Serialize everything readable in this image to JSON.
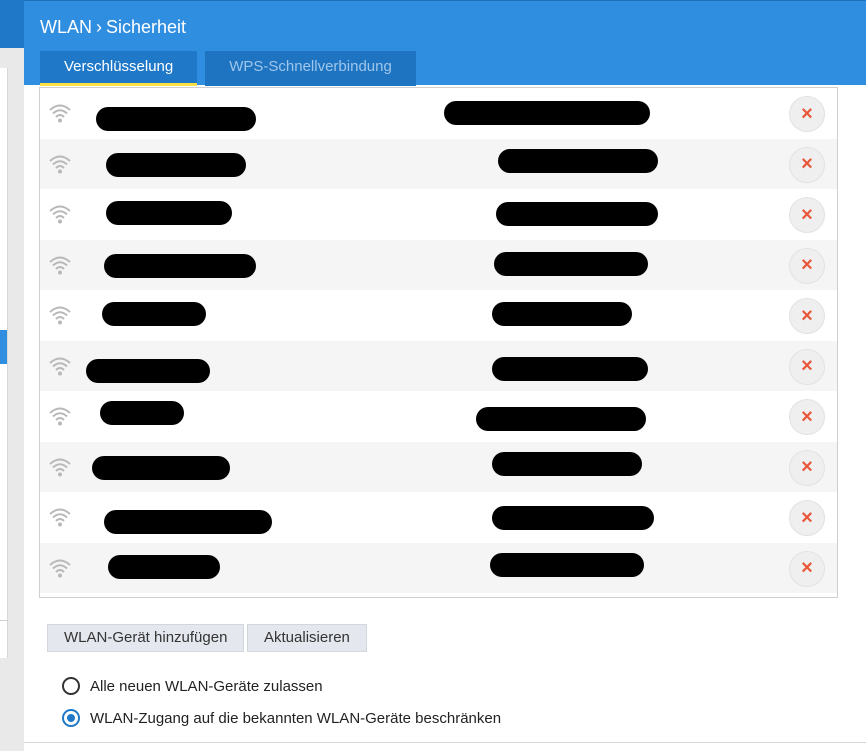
{
  "header": {
    "breadcrumb_root": "WLAN",
    "breadcrumb_sep": "›",
    "breadcrumb_current": "Sicherheit"
  },
  "tabs": [
    {
      "label": "Verschlüsselung",
      "active": true
    },
    {
      "label": "WPS-Schnellverbindung",
      "active": false
    }
  ],
  "device_list": {
    "rows": [
      {
        "icon": "wifi-icon",
        "name": "[redacted]",
        "address": "[redacted]",
        "delete": "×"
      },
      {
        "icon": "wifi-icon",
        "name": "[redacted]",
        "address": "[redacted]",
        "delete": "×"
      },
      {
        "icon": "wifi-icon",
        "name": "[redacted]",
        "address": "[redacted]",
        "delete": "×"
      },
      {
        "icon": "wifi-icon",
        "name": "[redacted]",
        "address": "[redacted]",
        "delete": "×"
      },
      {
        "icon": "wifi-icon",
        "name": "[redacted]",
        "address": "[redacted]",
        "delete": "×"
      },
      {
        "icon": "wifi-icon",
        "name": "[redacted]",
        "address": "[redacted]",
        "delete": "×"
      },
      {
        "icon": "wifi-icon",
        "name": "[redacted]",
        "address": "[redacted]",
        "delete": "×"
      },
      {
        "icon": "wifi-icon",
        "name": "[redacted]",
        "address": "[redacted]",
        "delete": "×"
      },
      {
        "icon": "wifi-icon",
        "name": "[redacted]",
        "address": "[redacted]",
        "delete": "×"
      },
      {
        "icon": "wifi-icon",
        "name": "[redacted]",
        "address": "[redacted]",
        "delete": "×"
      }
    ]
  },
  "actions": {
    "add_device": "WLAN-Gerät hinzufügen",
    "refresh": "Aktualisieren"
  },
  "access": {
    "option_all": "Alle neuen WLAN-Geräte zulassen",
    "option_restrict": "WLAN-Zugang auf die bekannten WLAN-Geräte beschränken",
    "selected": "restrict"
  },
  "colors": {
    "header_blue": "#2f8ee0",
    "tab_blue": "#1f78c8",
    "tab_underline": "#ffe045",
    "delete_red": "#e8573a"
  }
}
